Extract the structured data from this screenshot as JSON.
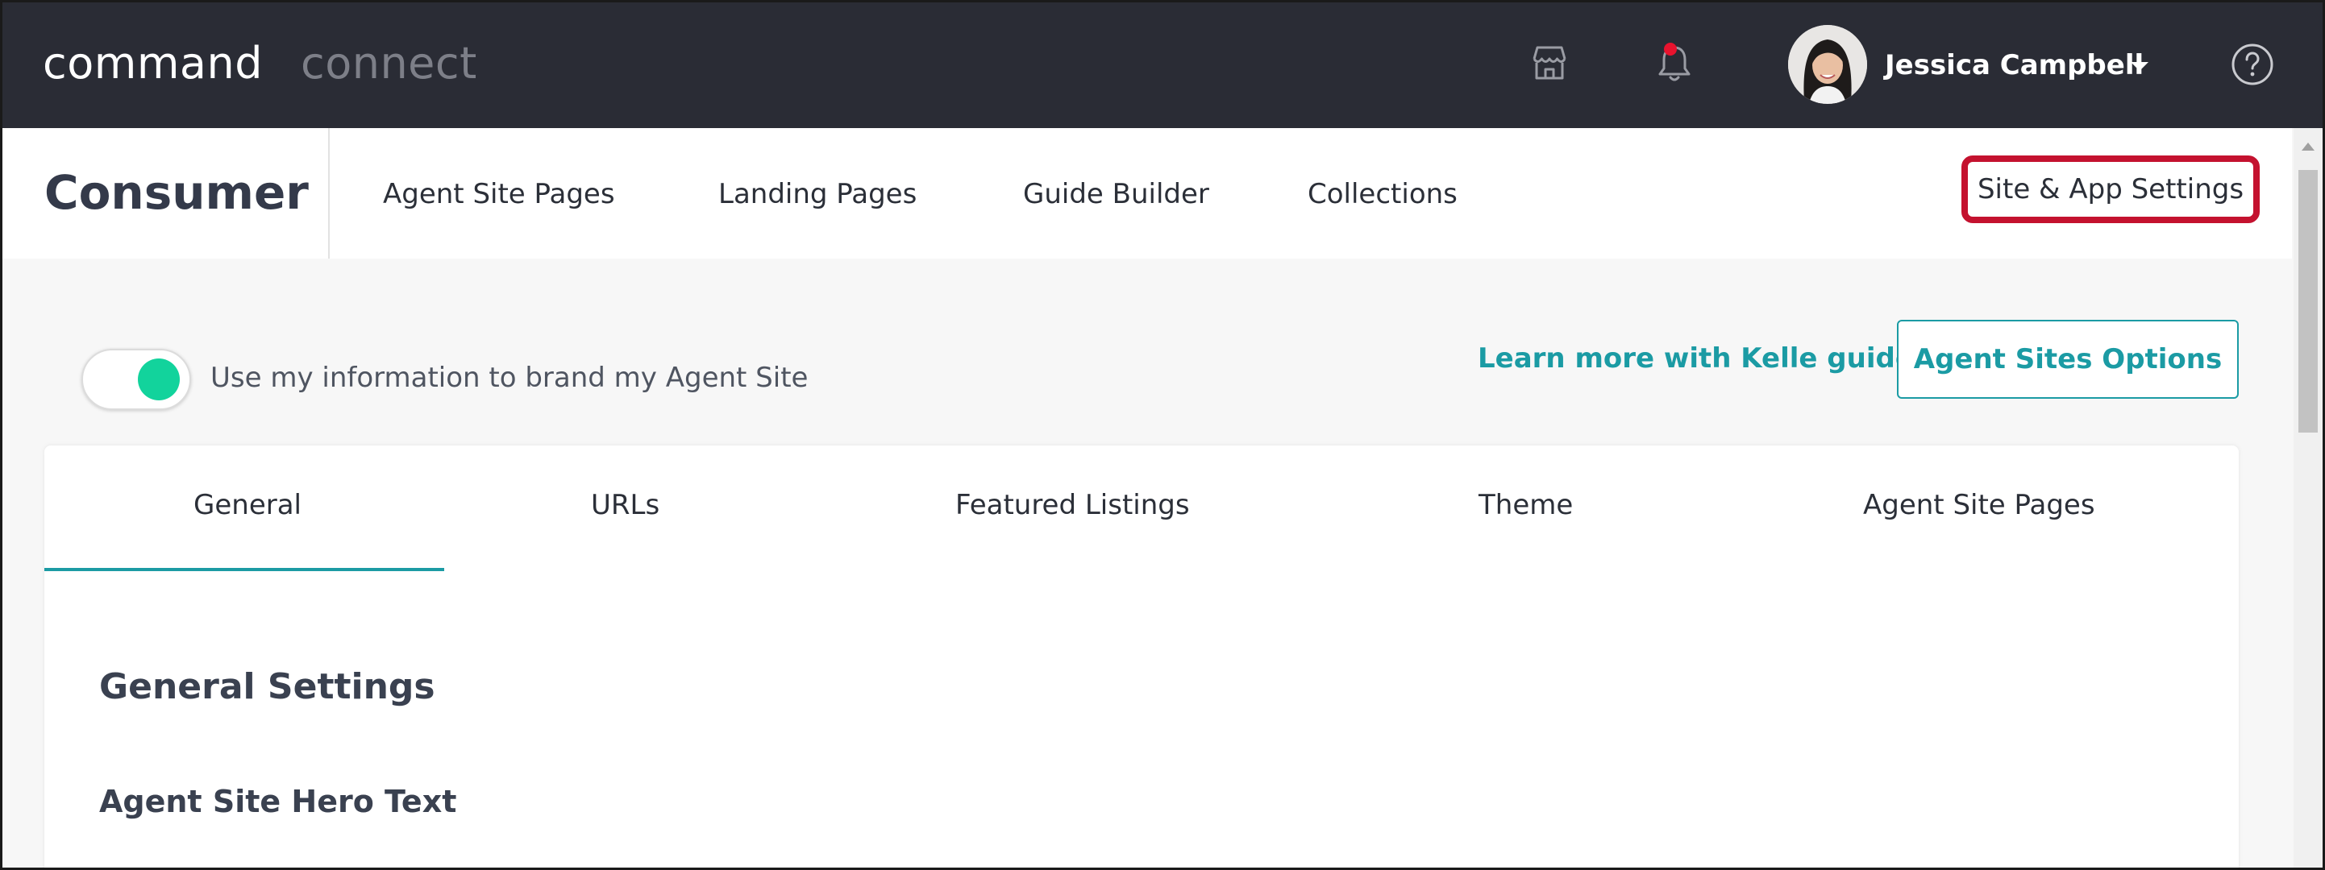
{
  "header": {
    "brand_primary": "command",
    "brand_secondary": "connect",
    "icons": [
      "store-icon",
      "bell-icon",
      "help-icon"
    ],
    "notification_dot_color": "#e8132e",
    "user": {
      "name": "Jessica Campbell"
    }
  },
  "subnav": {
    "section_title": "Consumer",
    "items": [
      {
        "label": "Agent Site Pages"
      },
      {
        "label": "Landing Pages"
      },
      {
        "label": "Guide Builder"
      },
      {
        "label": "Collections"
      }
    ],
    "settings_label": "Site & App Settings",
    "highlight_color": "#c4122f"
  },
  "toolbar": {
    "toggle_label": "Use my information to brand my Agent Site",
    "toggle_on": true,
    "learn_link": "Learn more with Kelle guides",
    "options_button": "Agent Sites Options",
    "accent_color": "#1b9ba4"
  },
  "tabs": [
    {
      "label": "General",
      "active": true
    },
    {
      "label": "URLs",
      "active": false
    },
    {
      "label": "Featured Listings",
      "active": false
    },
    {
      "label": "Theme",
      "active": false
    },
    {
      "label": "Agent Site Pages",
      "active": false
    }
  ],
  "content": {
    "heading": "General Settings",
    "field_label": "Agent Site Hero Text"
  }
}
